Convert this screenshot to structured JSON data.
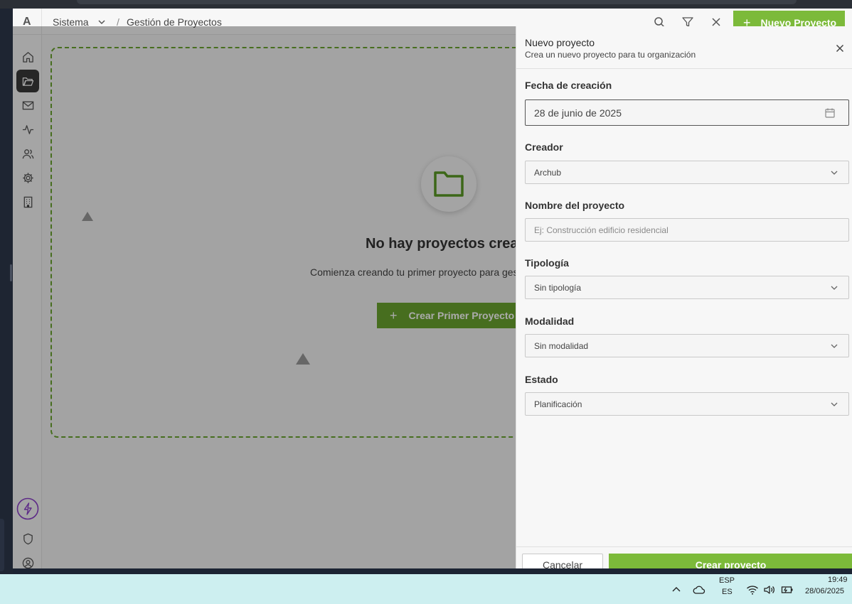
{
  "app": {
    "logo": "A",
    "breadcrumb": {
      "section": "Sistema",
      "separator": "/",
      "page": "Gestión de Proyectos"
    },
    "new_project_label": "Nuevo Proyecto"
  },
  "sidebar": {
    "items": [
      {
        "icon": "home-icon",
        "active": false
      },
      {
        "icon": "folder-open-icon",
        "active": true
      },
      {
        "icon": "mail-icon",
        "active": false
      },
      {
        "icon": "activity-icon",
        "active": false
      },
      {
        "icon": "users-icon",
        "active": false
      },
      {
        "icon": "gear-icon",
        "active": false
      },
      {
        "icon": "building-icon",
        "active": false
      }
    ],
    "bottom_items": [
      "lightning-icon",
      "shield-icon",
      "user-circle-icon"
    ]
  },
  "empty_state": {
    "title": "No hay proyectos creados",
    "description": "Comienza creando tu primer proyecto para gestionar",
    "button_label": "Crear Primer Proyecto"
  },
  "panel": {
    "title": "Nuevo proyecto",
    "subtitle": "Crea un nuevo proyecto para tu organización",
    "fields": {
      "creation_date": {
        "label": "Fecha de creación",
        "value": "28 de junio de 2025"
      },
      "creator": {
        "label": "Creador",
        "value": "Archub"
      },
      "project_name": {
        "label": "Nombre del proyecto",
        "placeholder": "Ej: Construcción edificio residencial"
      },
      "typology": {
        "label": "Tipología",
        "value": "Sin tipología"
      },
      "modality": {
        "label": "Modalidad",
        "value": "Sin modalidad"
      },
      "status": {
        "label": "Estado",
        "value": "Planificación"
      }
    },
    "cancel_label": "Cancelar",
    "create_label": "Crear proyecto"
  },
  "taskbar": {
    "lang_top": "ESP",
    "lang_bottom": "ES",
    "time": "19:49",
    "date": "28/06/2025"
  },
  "colors": {
    "accent": "#7cba3a",
    "accent_dark": "#6aa42f",
    "sidebar_active": "#3a3a3a"
  }
}
